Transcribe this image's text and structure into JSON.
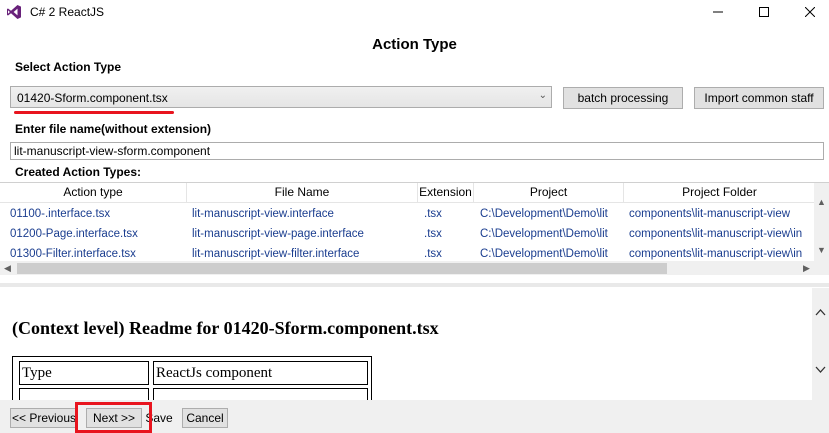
{
  "window": {
    "title": "C# 2 ReactJS"
  },
  "heading": "Action Type",
  "select_action": {
    "label": "Select Action Type",
    "selected_value": "01420-Sform.component.tsx"
  },
  "buttons": {
    "batch": "batch processing",
    "import": "Import common staff"
  },
  "file_name": {
    "label": "Enter file name(without extension)",
    "value": "lit-manuscript-view-sform.component"
  },
  "created_label": "Created Action Types:",
  "grid": {
    "columns": [
      "Action type",
      "File Name",
      "Extension",
      "Project",
      "Project Folder"
    ],
    "rows": [
      [
        "01100-.interface.tsx",
        "lit-manuscript-view.interface",
        ".tsx",
        "C:\\Development\\Demo\\lit",
        "components\\lit-manuscript-view"
      ],
      [
        "01200-Page.interface.tsx",
        "lit-manuscript-view-page.interface",
        ".tsx",
        "C:\\Development\\Demo\\lit",
        "components\\lit-manuscript-view\\in"
      ],
      [
        "01300-Filter.interface.tsx",
        "lit-manuscript-view-filter.interface",
        ".tsx",
        "C:\\Development\\Demo\\lit",
        "components\\lit-manuscript-view\\in"
      ]
    ]
  },
  "readme": {
    "title": "(Context level) Readme for 01420-Sform.component.tsx",
    "table_row": {
      "key": "Type",
      "value": "ReactJs component"
    }
  },
  "bottom": {
    "previous": "<< Previous",
    "next": "Next >>",
    "save": "Save",
    "cancel": "Cancel"
  },
  "colors": {
    "highlight": "#e8141e",
    "vs_purple": "#68217a",
    "grid_text": "#1a3d8f"
  }
}
